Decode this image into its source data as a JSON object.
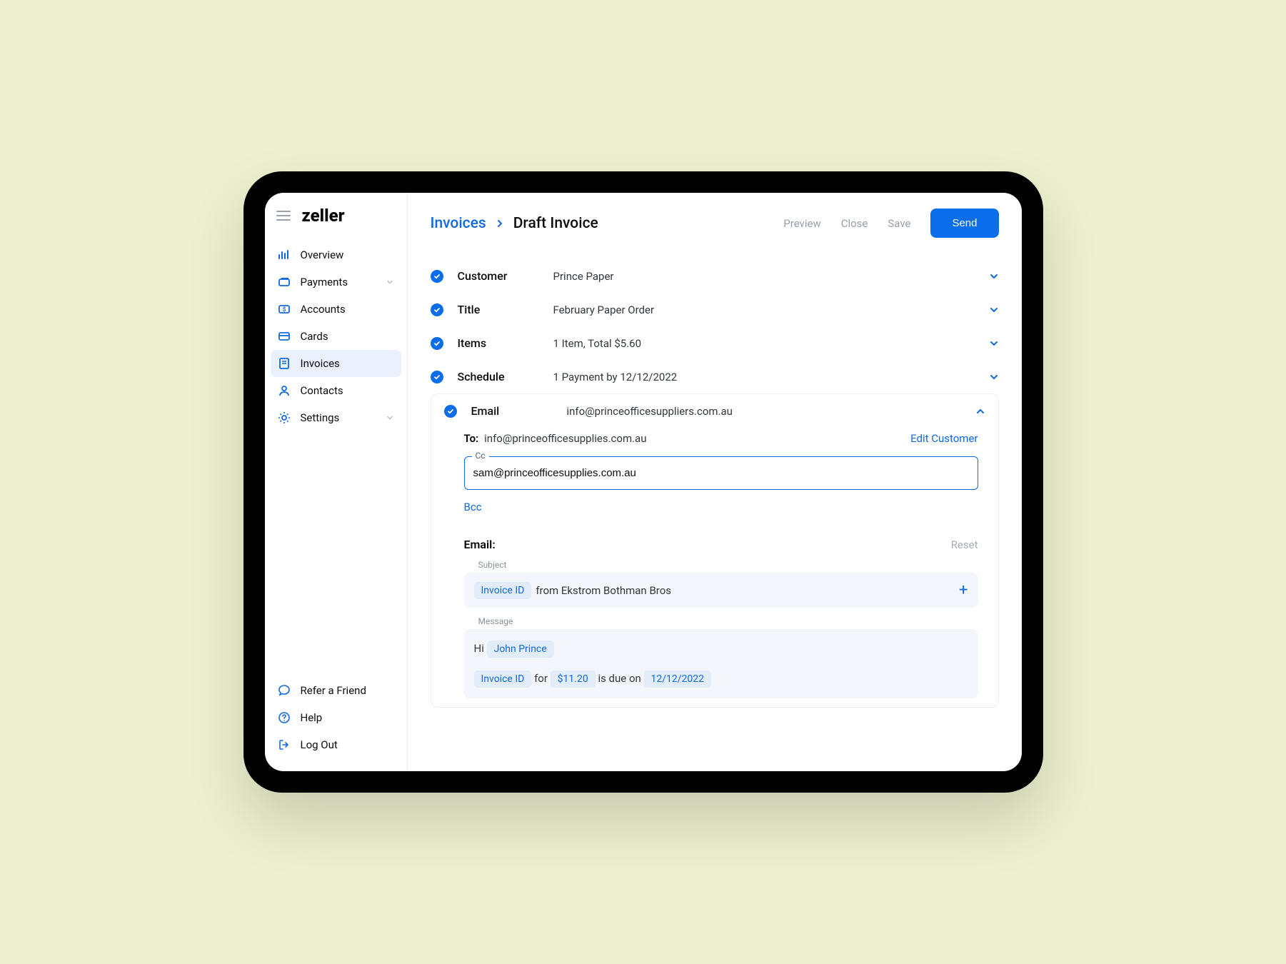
{
  "logo": "zeller",
  "nav": {
    "overview": "Overview",
    "payments": "Payments",
    "accounts": "Accounts",
    "cards": "Cards",
    "invoices": "Invoices",
    "contacts": "Contacts",
    "settings": "Settings"
  },
  "footer": {
    "refer": "Refer a Friend",
    "help": "Help",
    "logout": "Log Out"
  },
  "breadcrumb": {
    "parent": "Invoices",
    "current": "Draft Invoice"
  },
  "actions": {
    "preview": "Preview",
    "close": "Close",
    "save": "Save",
    "send": "Send"
  },
  "sections": {
    "customer": {
      "label": "Customer",
      "value": "Prince Paper"
    },
    "title": {
      "label": "Title",
      "value": "February Paper Order"
    },
    "items": {
      "label": "Items",
      "value": "1 Item, Total $5.60"
    },
    "schedule": {
      "label": "Schedule",
      "value": "1 Payment by 12/12/2022"
    },
    "email": {
      "label": "Email",
      "value": "info@princeofficesuppliers.com.au"
    }
  },
  "email_panel": {
    "to_label": "To:",
    "to_value": "info@princeofficesupplies.com.au",
    "edit_customer": "Edit Customer",
    "cc_label": "Cc",
    "cc_value": "sam@princeofficesupplies.com.au",
    "bcc": "Bcc",
    "compose_label": "Email:",
    "reset": "Reset",
    "subject_caption": "Subject",
    "subject_token": "Invoice ID",
    "subject_rest": "from Ekstrom Bothman Bros",
    "message_caption": "Message",
    "msg_hi": "Hi",
    "msg_name_token": "John Prince",
    "msg_invoice_token": "Invoice ID",
    "msg_for": "for",
    "msg_amount_token": "$11.20",
    "msg_due": "is due on",
    "msg_date_token": "12/12/2022"
  }
}
